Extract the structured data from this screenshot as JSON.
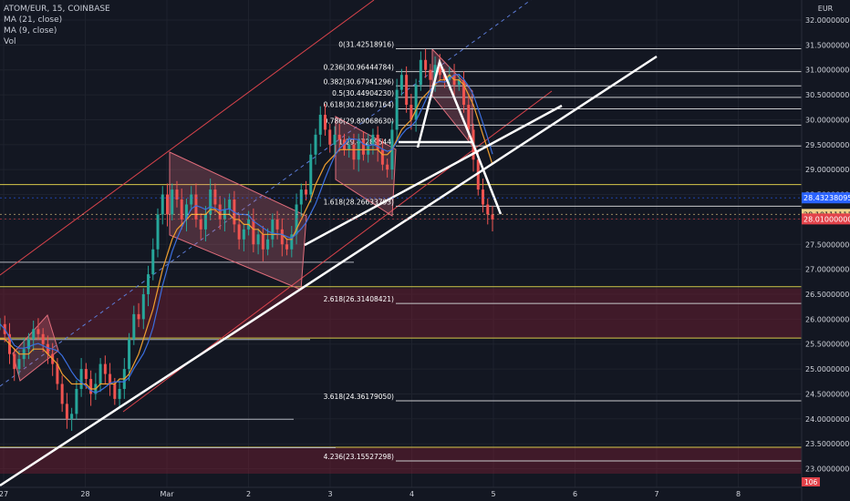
{
  "header": {
    "symbol_line": "ATOM/EUR, 15, COINBASE",
    "ma21_label": "MA (21, close)",
    "ma9_label": "MA (9, close)",
    "vol_label": "Vol"
  },
  "currency": "EUR",
  "chart_data": {
    "type": "candlestick",
    "price_axis": {
      "range": [
        22.9,
        32.0
      ],
      "ticks": [
        "32.00000000",
        "31.50000000",
        "31.00000000",
        "30.50000000",
        "30.00000000",
        "29.50000000",
        "29.00000000",
        "28.50000000",
        "28.00000000",
        "27.50000000",
        "27.00000000",
        "26.50000000",
        "26.00000000",
        "25.50000000",
        "25.00000000",
        "24.50000000",
        "24.00000000",
        "23.50000000",
        "23.00000000"
      ]
    },
    "time_axis": {
      "ticks": [
        {
          "label": "27",
          "day": 0
        },
        {
          "label": "28",
          "day": 1
        },
        {
          "label": "Mar",
          "day": 2
        },
        {
          "label": "2",
          "day": 3
        },
        {
          "label": "3",
          "day": 4
        },
        {
          "label": "4",
          "day": 5
        },
        {
          "label": "5",
          "day": 6
        },
        {
          "label": "6",
          "day": 7
        },
        {
          "label": "7",
          "day": 8
        },
        {
          "label": "8",
          "day": 9
        }
      ]
    },
    "price_tags": [
      {
        "value": 28.43238095,
        "text": "28.43238095",
        "color": "#2962ff",
        "text_color": "#ffffff"
      },
      {
        "value": 28.10111111,
        "text": "28.10111111",
        "color": "#f0d28a",
        "text_color": "#131722"
      },
      {
        "value": 28.01,
        "text": "28.01000000",
        "color": "#e2434b",
        "text_color": "#ffffff"
      }
    ],
    "volume_tag": {
      "text": "106",
      "color": "#e2434b"
    },
    "fib_levels": [
      {
        "label": "0(31.42518916)",
        "value": 31.42518916
      },
      {
        "label": "0.236(30.96444784)",
        "value": 30.96444784
      },
      {
        "label": "0.382(30.67941296)",
        "value": 30.67941296
      },
      {
        "label": "0.5(30.44904230)",
        "value": 30.4490423
      },
      {
        "label": "0.618(30.21867164)",
        "value": 30.21867164
      },
      {
        "label": "0.786(29.89068630)",
        "value": 29.8906863
      },
      {
        "label": "1(29.47289544)",
        "value": 29.47289544
      },
      {
        "label": "1.618(28.26633793)",
        "value": 28.26633793
      },
      {
        "label": "2.618(26.31408421)",
        "value": 26.31408421
      },
      {
        "label": "3.618(24.36179050)",
        "value": 24.3617905
      },
      {
        "label": "4.236(23.15527298)",
        "value": 23.15527298
      }
    ],
    "zones": [
      {
        "from": 25.62,
        "to": 26.62
      },
      {
        "from": 22.9,
        "to": 23.43
      }
    ],
    "horizontal_levels": [
      28.7,
      26.65,
      25.62,
      23.43
    ],
    "candles_close": [
      25.9,
      25.7,
      25.3,
      25.0,
      25.2,
      25.4,
      25.6,
      25.8,
      25.7,
      25.5,
      25.3,
      25.1,
      24.7,
      24.3,
      24.0,
      24.1,
      24.6,
      25.0,
      24.8,
      24.5,
      24.7,
      25.1,
      24.9,
      24.7,
      24.4,
      24.6,
      25.0,
      25.6,
      26.1,
      26.0,
      26.5,
      26.9,
      27.4,
      28.1,
      28.5,
      28.1,
      28.6,
      28.4,
      28.0,
      28.3,
      28.5,
      28.0,
      27.8,
      28.1,
      28.6,
      28.3,
      28.0,
      28.2,
      28.4,
      27.9,
      27.6,
      27.8,
      28.0,
      27.5,
      27.7,
      27.4,
      27.6,
      28.0,
      27.8,
      27.5,
      27.4,
      27.7,
      28.3,
      28.6,
      28.5,
      29.3,
      29.7,
      30.1,
      29.8,
      29.5,
      29.7,
      29.6,
      29.4,
      29.5,
      29.2,
      29.6,
      29.3,
      29.5,
      29.7,
      29.4,
      29.1,
      29.0,
      29.8,
      30.6,
      30.9,
      30.3,
      30.0,
      30.7,
      31.2,
      31.0,
      30.8,
      31.1,
      30.9,
      30.8,
      30.9,
      30.7,
      30.8,
      30.3,
      29.8,
      29.2,
      28.6,
      28.3,
      28.1,
      28.0
    ],
    "ma21": [
      25.6,
      25.6,
      25.5,
      25.4,
      25.3,
      25.3,
      25.3,
      25.4,
      25.4,
      25.4,
      25.3,
      25.2,
      25.1,
      24.9,
      24.8,
      24.7,
      24.7,
      24.7,
      24.7,
      24.6,
      24.6,
      24.7,
      24.7,
      24.7,
      24.7,
      24.8,
      24.8,
      24.9,
      25.1,
      25.3,
      25.6,
      25.9,
      26.2,
      26.6,
      27.0,
      27.3,
      27.6,
      27.8,
      27.9,
      28.0,
      28.1,
      28.1,
      28.1,
      28.1,
      28.2,
      28.2,
      28.1,
      28.1,
      28.1,
      28.0,
      28.0,
      27.9,
      27.9,
      27.8,
      27.8,
      27.7,
      27.7,
      27.7,
      27.7,
      27.7,
      27.6,
      27.6,
      27.8,
      28.0,
      28.2,
      28.4,
      28.7,
      28.9,
      29.1,
      29.2,
      29.3,
      29.4,
      29.4,
      29.4,
      29.4,
      29.4,
      29.4,
      29.4,
      29.4,
      29.4,
      29.3,
      29.3,
      29.4,
      29.6,
      29.8,
      29.9,
      30.0,
      30.2,
      30.4,
      30.5,
      30.6,
      30.7,
      30.8,
      30.8,
      30.9,
      30.8,
      30.8,
      30.7,
      30.5,
      30.3,
      30.0,
      29.7,
      29.4,
      29.1
    ]
  }
}
